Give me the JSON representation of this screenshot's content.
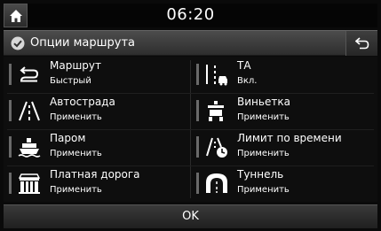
{
  "status": {
    "time": "06:20"
  },
  "header": {
    "title": "Опции маршрута"
  },
  "options": [
    {
      "label": "Маршрут",
      "value": "Быстрый",
      "icon": "route-icon"
    },
    {
      "label": "ТА",
      "value": "Вкл.",
      "icon": "traffic-icon"
    },
    {
      "label": "Автострада",
      "value": "Применить",
      "icon": "motorway-icon"
    },
    {
      "label": "Виньетка",
      "value": "Применить",
      "icon": "vignette-icon"
    },
    {
      "label": "Паром",
      "value": "Применить",
      "icon": "ferry-icon"
    },
    {
      "label": "Лимит по времени",
      "value": "Применить",
      "icon": "time-limit-icon"
    },
    {
      "label": "Платная дорога",
      "value": "Применить",
      "icon": "toll-road-icon"
    },
    {
      "label": "Туннель",
      "value": "Применить",
      "icon": "tunnel-icon"
    }
  ],
  "footer": {
    "ok_label": "OK"
  }
}
